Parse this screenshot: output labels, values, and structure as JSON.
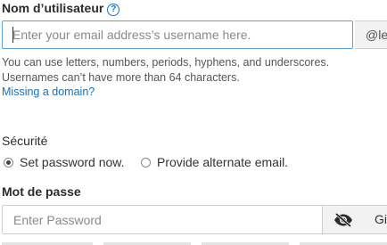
{
  "username": {
    "label": "Nom d’utilisateur",
    "help_glyph": "?",
    "placeholder": "Enter your email address’s username here.",
    "value": "",
    "domain_suffix": "@le",
    "hint": "You can use letters, numbers, periods, hyphens, and underscores. Usernames can’t have more than 64 characters.",
    "missing_domain_link": "Missing a domain?"
  },
  "security": {
    "label": "Sécurité",
    "options": [
      {
        "label": "Set password now.",
        "selected": true
      },
      {
        "label": "Provide alternate email.",
        "selected": false
      }
    ]
  },
  "password": {
    "label": "Mot de passe",
    "placeholder": "Enter Password",
    "value": "",
    "visibility_icon": "eye-slash-icon",
    "generate_label": "Gi"
  },
  "colors": {
    "link": "#1a6fb8",
    "focus_border": "#5aa3dd",
    "addon_bg": "#f2f2f2"
  }
}
